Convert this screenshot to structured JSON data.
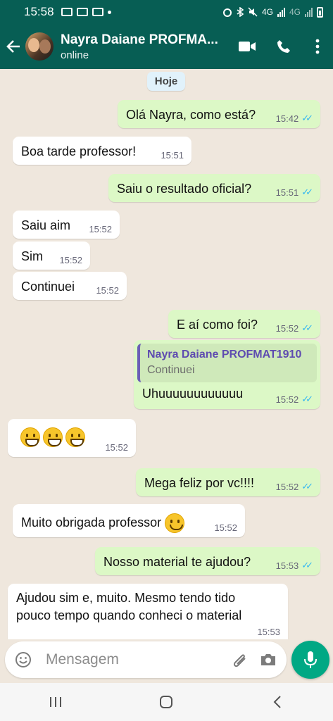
{
  "status_bar": {
    "time": "15:58",
    "network_labels": [
      "4G",
      "4G"
    ],
    "colors": {
      "background": "#075e54"
    }
  },
  "header": {
    "contact_name": "Nayra Daiane PROFMA...",
    "status": "online",
    "icons": [
      "back-arrow-icon",
      "avatar",
      "video-call-icon",
      "phone-call-icon",
      "more-options-icon"
    ]
  },
  "chat": {
    "date_divider": "Hoje",
    "messages": [
      {
        "id": "m1",
        "direction": "out",
        "text": "Olá Nayra, como está?",
        "time": "15:42",
        "read": true
      },
      {
        "id": "m2",
        "direction": "in",
        "text": "Boa tarde professor!",
        "time": "15:51"
      },
      {
        "id": "m3",
        "direction": "out",
        "text": "Saiu o resultado oficial?",
        "time": "15:51",
        "read": true
      },
      {
        "id": "m4",
        "direction": "in",
        "text": "Saiu aim",
        "time": "15:52"
      },
      {
        "id": "m5",
        "direction": "in",
        "text": "Sim",
        "time": "15:52"
      },
      {
        "id": "m6",
        "direction": "in",
        "text": "Continuei",
        "time": "15:52"
      },
      {
        "id": "m7",
        "direction": "out",
        "text": "E aí como foi?",
        "time": "15:52",
        "read": true
      },
      {
        "id": "m8",
        "direction": "out",
        "text": "Uhuuuuuuuuuuuu",
        "time": "15:52",
        "read": true,
        "quote": {
          "author": "Nayra Daiane PROFMAT1910",
          "text": "Continuei"
        }
      },
      {
        "id": "m9",
        "direction": "in",
        "emojis": [
          "grinning-face",
          "grinning-face",
          "grinning-face"
        ],
        "time": "15:52"
      },
      {
        "id": "m10",
        "direction": "out",
        "text": "Mega feliz por vc!!!!",
        "time": "15:52",
        "read": true
      },
      {
        "id": "m11",
        "direction": "in",
        "text": "Muito obrigada professor",
        "emoji": "smiling-face",
        "time": "15:52"
      },
      {
        "id": "m12",
        "direction": "out",
        "text": "Nosso material te ajudou?",
        "time": "15:53",
        "read": true
      },
      {
        "id": "m13",
        "direction": "in",
        "text_line_1": "Ajudou sim e, muito. Mesmo tendo tido",
        "text_line_2": "pouco tempo quando conheci o material",
        "time": "15:53"
      }
    ],
    "colors": {
      "incoming": "#ffffff",
      "outgoing": "#dcf8c6",
      "read_ticks": "#34b7f1",
      "background": "#efe7dd"
    }
  },
  "composer": {
    "placeholder": "Mensagem",
    "icons": [
      "emoji-icon",
      "attach-icon",
      "camera-icon",
      "mic-icon"
    ],
    "colors": {
      "mic_button": "#00a884"
    }
  },
  "nav_bar": {
    "icons": [
      "recent-apps-icon",
      "home-icon",
      "back-icon"
    ]
  }
}
